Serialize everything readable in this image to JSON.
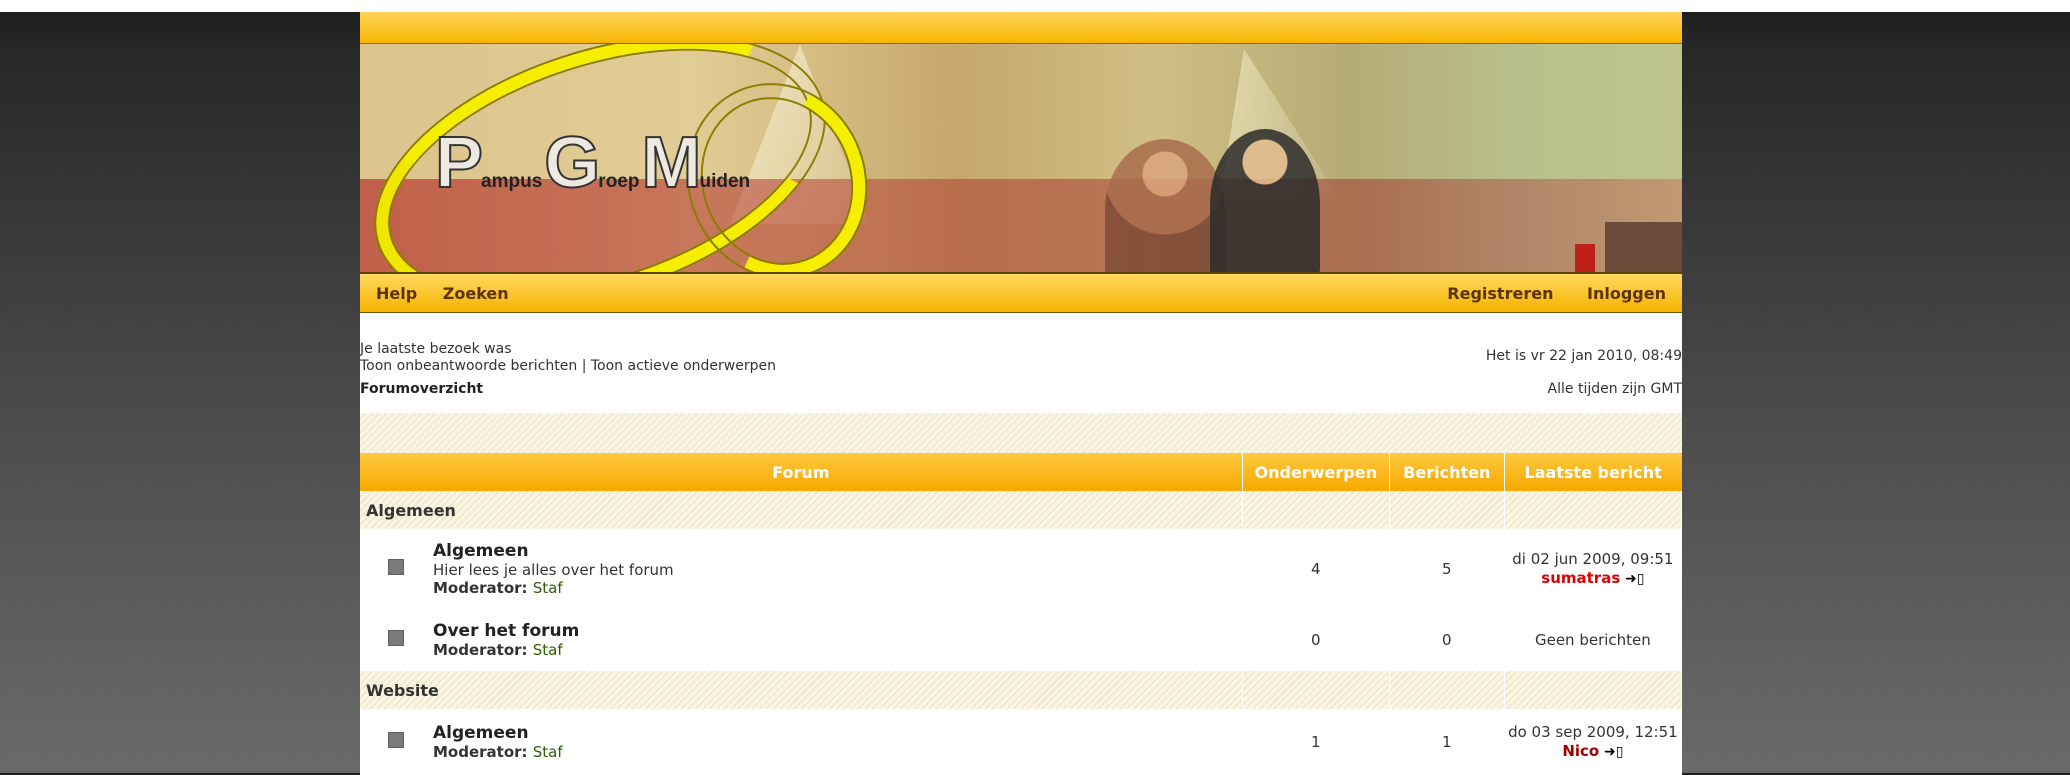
{
  "logo": {
    "letters": [
      {
        "big": "P",
        "small": "ampus"
      },
      {
        "big": "G",
        "small": "roep"
      },
      {
        "big": "M",
        "small": "uiden"
      }
    ]
  },
  "nav": {
    "left": [
      "Help",
      "Zoeken"
    ],
    "right": [
      "Registreren",
      "Inloggen"
    ]
  },
  "info": {
    "last_visit": "Je laatste bezoek was",
    "links": "Toon onbeantwoorde berichten | Toon actieve onderwerpen",
    "breadcrumb": "Forumoverzicht",
    "current_time": "Het is vr 22 jan 2010, 08:49",
    "timezone": "Alle tijden zijn GMT"
  },
  "table": {
    "headers": [
      "Forum",
      "Onderwerpen",
      "Berichten",
      "Laatste bericht"
    ]
  },
  "categories": [
    {
      "name": "Algemeen",
      "forums": [
        {
          "title": "Algemeen",
          "description": "Hier lees je alles over het forum",
          "moderator_label": "Moderator:",
          "moderator": "Staf",
          "topics": "4",
          "posts": "5",
          "last_date": "di 02 jun 2009, 09:51",
          "last_user": "sumatras"
        },
        {
          "title": "Over het forum",
          "description": "",
          "moderator_label": "Moderator:",
          "moderator": "Staf",
          "topics": "0",
          "posts": "0",
          "last_date": "Geen berichten",
          "last_user": ""
        }
      ]
    },
    {
      "name": "Website",
      "forums": [
        {
          "title": "Algemeen",
          "description": "",
          "moderator_label": "Moderator:",
          "moderator": "Staf",
          "topics": "1",
          "posts": "1",
          "last_date": "do 03 sep 2009, 12:51",
          "last_user": "Nico"
        }
      ]
    }
  ],
  "colors": {
    "accent": "#f7b300",
    "user_red": "#e00000",
    "user_dark_red": "#a00000",
    "moderator_green": "#2e5e00"
  }
}
